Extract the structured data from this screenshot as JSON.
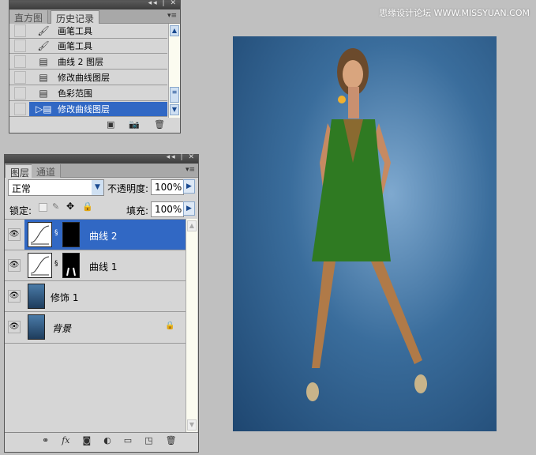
{
  "watermark": "思缘设计论坛 WWW.MISSYUAN.COM",
  "history_panel": {
    "tabs": [
      "直方图",
      "历史记录"
    ],
    "active_tab": 1,
    "items": [
      {
        "label": "画笔工具",
        "icon": "brush-icon"
      },
      {
        "label": "画笔工具",
        "icon": "brush-icon"
      },
      {
        "label": "曲线 2 图层",
        "icon": "history-state-icon"
      },
      {
        "label": "修改曲线图层",
        "icon": "history-state-icon"
      },
      {
        "label": "色彩范围",
        "icon": "history-state-icon"
      },
      {
        "label": "修改曲线图层",
        "icon": "history-state-icon",
        "selected": true
      }
    ]
  },
  "layers_panel": {
    "tabs": [
      "图层",
      "通道"
    ],
    "blend_mode": "正常",
    "opacity_label": "不透明度:",
    "opacity": "100%",
    "lock_label": "锁定:",
    "fill_label": "填充:",
    "fill": "100%",
    "layers": [
      {
        "name": "曲线 2",
        "type": "curves",
        "selected": true
      },
      {
        "name": "曲线 1",
        "type": "curves"
      },
      {
        "name": "修饰 1",
        "type": "image"
      },
      {
        "name": "背景",
        "type": "image",
        "locked": true
      }
    ]
  },
  "colors": {
    "selection": "#3168c4",
    "photo_bg": "#3a6d9c",
    "dress": "#2f7a22"
  }
}
